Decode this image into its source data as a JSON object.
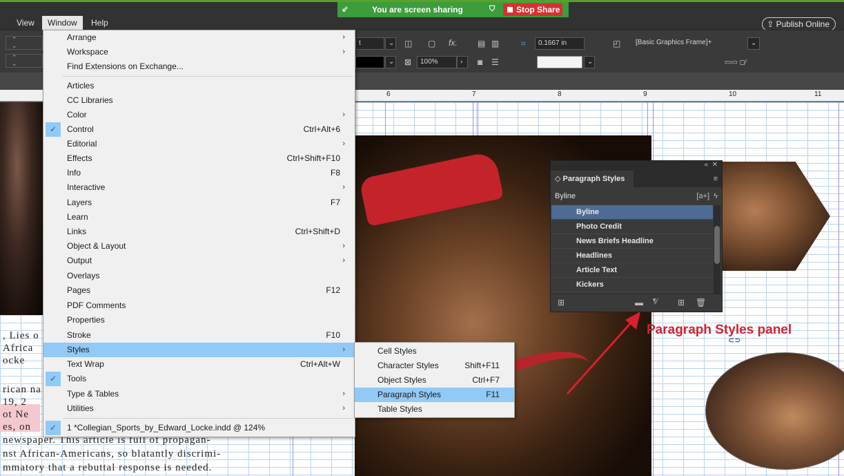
{
  "menubar": {
    "items": [
      "View",
      "Window",
      "Help"
    ],
    "active": "Window",
    "publish_label": "Publish Online"
  },
  "share_bar": {
    "message": "You are screen sharing",
    "stop_label": "Stop Share"
  },
  "control_panel": {
    "stroke_unit_hint": "t",
    "zoom_value": "100%",
    "offset_value": "0.1667 in",
    "object_style": "[Basic Graphics Frame]+"
  },
  "ruler": {
    "labels": [
      "6",
      "7",
      "8",
      "9",
      "10",
      "11"
    ]
  },
  "window_menu": {
    "items": [
      {
        "label": "Arrange",
        "shortcut": "",
        "submenu": true,
        "checked": false
      },
      {
        "label": "Workspace",
        "shortcut": "",
        "submenu": true,
        "checked": false
      },
      {
        "label": "Find Extensions on Exchange...",
        "shortcut": "",
        "submenu": false,
        "checked": false
      },
      {
        "label": "Articles",
        "shortcut": "",
        "submenu": false,
        "checked": false
      },
      {
        "label": "CC Libraries",
        "shortcut": "",
        "submenu": false,
        "checked": false
      },
      {
        "label": "Color",
        "shortcut": "",
        "submenu": true,
        "checked": false
      },
      {
        "label": "Control",
        "shortcut": "Ctrl+Alt+6",
        "submenu": false,
        "checked": true
      },
      {
        "label": "Editorial",
        "shortcut": "",
        "submenu": true,
        "checked": false
      },
      {
        "label": "Effects",
        "shortcut": "Ctrl+Shift+F10",
        "submenu": false,
        "checked": false
      },
      {
        "label": "Info",
        "shortcut": "F8",
        "submenu": false,
        "checked": false
      },
      {
        "label": "Interactive",
        "shortcut": "",
        "submenu": true,
        "checked": false
      },
      {
        "label": "Layers",
        "shortcut": "F7",
        "submenu": false,
        "checked": false
      },
      {
        "label": "Learn",
        "shortcut": "",
        "submenu": false,
        "checked": false
      },
      {
        "label": "Links",
        "shortcut": "Ctrl+Shift+D",
        "submenu": false,
        "checked": false
      },
      {
        "label": "Object & Layout",
        "shortcut": "",
        "submenu": true,
        "checked": false
      },
      {
        "label": "Output",
        "shortcut": "",
        "submenu": true,
        "checked": false
      },
      {
        "label": "Overlays",
        "shortcut": "",
        "submenu": false,
        "checked": false
      },
      {
        "label": "Pages",
        "shortcut": "F12",
        "submenu": false,
        "checked": false
      },
      {
        "label": "PDF Comments",
        "shortcut": "",
        "submenu": false,
        "checked": false
      },
      {
        "label": "Properties",
        "shortcut": "",
        "submenu": false,
        "checked": false
      },
      {
        "label": "Stroke",
        "shortcut": "F10",
        "submenu": false,
        "checked": false
      },
      {
        "label": "Styles",
        "shortcut": "",
        "submenu": true,
        "checked": false,
        "highlighted": true
      },
      {
        "label": "Text Wrap",
        "shortcut": "Ctrl+Alt+W",
        "submenu": false,
        "checked": false
      },
      {
        "label": "Tools",
        "shortcut": "",
        "submenu": false,
        "checked": true
      },
      {
        "label": "Type & Tables",
        "shortcut": "",
        "submenu": true,
        "checked": false
      },
      {
        "label": "Utilities",
        "shortcut": "",
        "submenu": true,
        "checked": false
      },
      {
        "label": "1 *Collegian_Sports_by_Edward_Locke.indd @ 124%",
        "shortcut": "",
        "submenu": false,
        "checked": true
      }
    ]
  },
  "styles_submenu": {
    "items": [
      {
        "label": "Cell Styles",
        "shortcut": ""
      },
      {
        "label": "Character Styles",
        "shortcut": "Shift+F11"
      },
      {
        "label": "Object Styles",
        "shortcut": "Ctrl+F7"
      },
      {
        "label": "Paragraph Styles",
        "shortcut": "F11",
        "highlighted": true
      },
      {
        "label": "Table Styles",
        "shortcut": ""
      }
    ]
  },
  "paragraph_panel": {
    "title": "Paragraph Styles",
    "current_style": "Byline",
    "styles": [
      "Byline",
      "Photo Credit",
      "News Briefs Headline",
      "Headlines",
      "Article Text",
      "Kickers"
    ],
    "selected": "Byline"
  },
  "annotation": {
    "text": "Paragraph Styles panel",
    "color": "#d7212b"
  },
  "document_text": {
    "lines": [
      ", Lies o",
      "Africa",
      "ocke",
      "rican na",
      "19, 2",
      "ot Ne",
      "es, on",
      "newspaper. This article is full of propagan-",
      "nst African-Americans, so blatantly discrimi-",
      "mmatory that a rebuttal response is needed."
    ]
  },
  "colors": {
    "menu_highlight": "#91c9f7",
    "panel_selection": "#4d6b95",
    "share_green": "#3c9d3c",
    "stop_red": "#d8302f"
  }
}
